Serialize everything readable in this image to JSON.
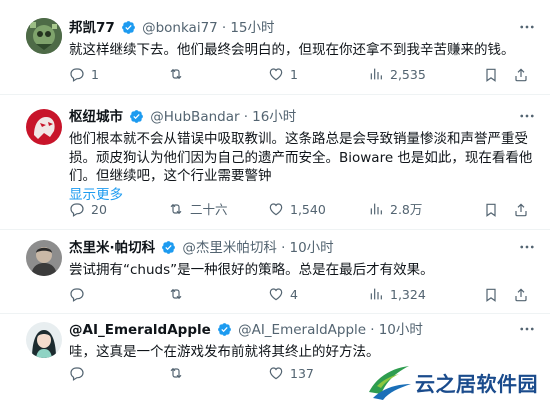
{
  "tweets": [
    {
      "name": "邦凯77",
      "handle": "@bonkai77",
      "time": "15小时",
      "text": [
        "就这样继续下去。他们最终会明白的，但现在你还拿不到我辛苦赚来的钱。"
      ],
      "show_more": "",
      "replies": "1",
      "retweets": "",
      "likes": "1",
      "views": "2,535"
    },
    {
      "name": "枢纽城市",
      "handle": "@HubBandar",
      "time": "16小时",
      "text": [
        "他们根本就不会从错误中吸取教训。这条路总是会导致销量惨淡和声誉严重受",
        "损。顽皮狗认为他们因为自己的遗产而安全。Bioware 也是如此，现在看看他",
        "们。但继续吧，这个行业需要警钟"
      ],
      "show_more": "显示更多",
      "replies": "20",
      "retweets": "二十六",
      "likes": "1,540",
      "views": "2.8万"
    },
    {
      "name": "杰里米·帕切科",
      "handle": "@杰里米帕切科",
      "time": "10小时",
      "text": [
        "尝试拥有“chuds”是一种很好的策略。总是在最后才有效果。"
      ],
      "show_more": "",
      "replies": "",
      "retweets": "",
      "likes": "4",
      "views": "1,324"
    },
    {
      "name": "@AI_EmeraldApple",
      "handle": "@AI_EmeraldApple",
      "time": "10小时",
      "text": [
        "哇，这真是一个在游戏发布前就将其终止的好方法。"
      ],
      "show_more": "",
      "replies": "",
      "retweets": "",
      "likes": "137",
      "views": ""
    }
  ],
  "watermark": {
    "text": "云之居软件园"
  },
  "colors": {
    "link": "#1d9bf0",
    "secondary": "#536471",
    "verified": "#1d9bf0",
    "divider": "#eff3f4"
  }
}
